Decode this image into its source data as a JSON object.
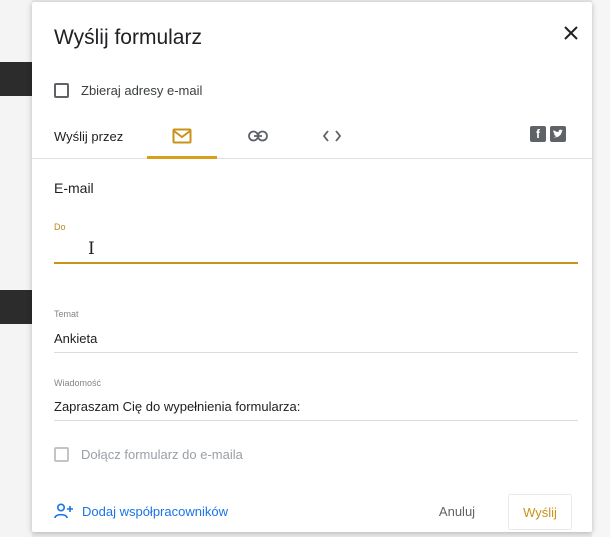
{
  "dialog": {
    "title": "Wyślij formularz",
    "close_icon": "close-icon",
    "collect_emails_label": "Zbieraj adresy e-mail",
    "send_via_label": "Wyślij przez",
    "tabs": [
      {
        "icon": "envelope-icon",
        "active": true
      },
      {
        "icon": "link-icon",
        "active": false
      },
      {
        "icon": "embed-code-icon",
        "active": false
      }
    ],
    "social_icons": [
      "facebook-icon",
      "twitter-icon"
    ],
    "email_section": {
      "title": "E-mail",
      "to_label": "Do",
      "to_value": "",
      "subject_label": "Temat",
      "subject_value": "Ankieta",
      "message_label": "Wiadomość",
      "message_value": "Zapraszam Cię do wypełnienia formularza:",
      "attach_form_label": "Dołącz formularz do e-maila"
    },
    "add_collaborators_label": "Dodaj współpracowników",
    "cancel_label": "Anuluj",
    "send_label": "Wyślij"
  },
  "colors": {
    "accent": "#d8a01a",
    "link_blue": "#1a73e8"
  }
}
